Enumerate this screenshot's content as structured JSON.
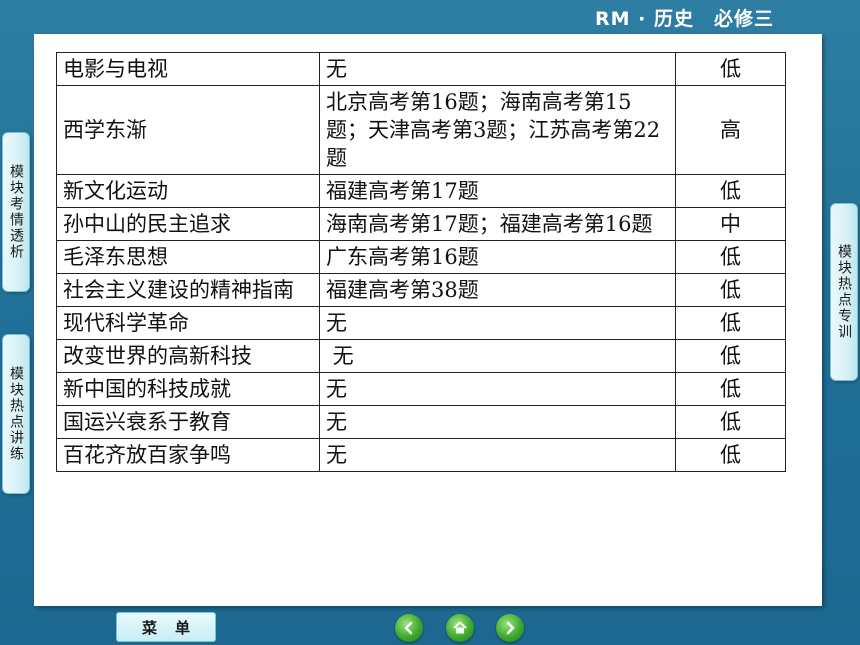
{
  "header": {
    "title": "RM · 历史　必修三"
  },
  "side_tabs": {
    "left_1": "模块考情透析",
    "left_2": "模块热点讲练",
    "right_1": "模块热点专训"
  },
  "table": {
    "rows": [
      {
        "topic": "电影与电视",
        "exams": "无",
        "level": "低"
      },
      {
        "topic": "西学东渐",
        "exams": "北京高考第16题；海南高考第15题；天津高考第3题；江苏高考第22题",
        "level": "高"
      },
      {
        "topic": "新文化运动",
        "exams": "福建高考第17题",
        "level": "低"
      },
      {
        "topic": "孙中山的民主追求",
        "exams": "海南高考第17题；福建高考第16题",
        "level": "中"
      },
      {
        "topic": "毛泽东思想",
        "exams": "广东高考第16题",
        "level": "低"
      },
      {
        "topic": "社会主义建设的精神指南",
        "exams": "福建高考第38题",
        "level": "低"
      },
      {
        "topic": "现代科学革命",
        "exams": "无",
        "level": "低"
      },
      {
        "topic": "改变世界的高新科技",
        "exams": " 无",
        "level": "低"
      },
      {
        "topic": "新中国的科技成就",
        "exams": "无",
        "level": "低"
      },
      {
        "topic": "国运兴衰系于教育",
        "exams": "无",
        "level": "低"
      },
      {
        "topic": "百花齐放百家争鸣",
        "exams": "无",
        "level": "低"
      }
    ]
  },
  "footer": {
    "menu_label": "菜单",
    "nav_icons": [
      "prev-icon",
      "home-icon",
      "next-icon"
    ]
  }
}
